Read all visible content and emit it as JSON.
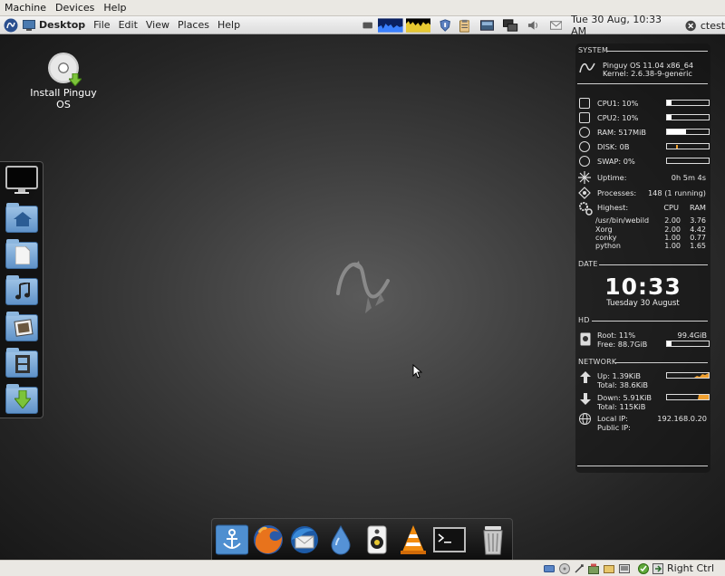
{
  "vbox_menu": {
    "items": [
      "Machine",
      "Devices",
      "Help"
    ]
  },
  "top_panel": {
    "crumb": "Desktop",
    "menus": [
      "File",
      "Edit",
      "View",
      "Places",
      "Help"
    ],
    "datetime": "Tue 30 Aug, 10:33 AM",
    "user": "ctest"
  },
  "desktop": {
    "icons": [
      {
        "label": "Install Pinguy OS",
        "icon": "cd-installer-icon"
      }
    ]
  },
  "left_dock": {
    "items": [
      "monitor-icon",
      "home-folder-icon",
      "documents-folder-icon",
      "music-folder-icon",
      "pictures-folder-icon",
      "videos-folder-icon",
      "downloads-folder-icon"
    ]
  },
  "conky": {
    "system_header": "SYSTEM",
    "os_name": "Pinguy OS 11.04 x86_64",
    "kernel": "Kernel: 2.6.38-9-generic",
    "cpu1": {
      "label": "CPU1: 10%",
      "level": 0.1
    },
    "cpu2": {
      "label": "CPU2: 10%",
      "level": 0.1
    },
    "ram": {
      "label": "RAM: 517MiB",
      "level": 0.45
    },
    "disk": {
      "label": "DISK: 0B",
      "level": 0.0
    },
    "swap": {
      "label": "SWAP: 0%",
      "level": 0.0
    },
    "uptime": {
      "label": "Uptime:",
      "value": "0h 5m 4s"
    },
    "processes": {
      "label": "Processes:",
      "value": "148 (1 running)"
    },
    "highest": {
      "label": "Highest:",
      "cpu_header": "CPU",
      "ram_header": "RAM",
      "rows": [
        {
          "name": "/usr/bin/webild",
          "cpu": "2.00",
          "ram": "3.76"
        },
        {
          "name": "Xorg",
          "cpu": "2.00",
          "ram": "4.42"
        },
        {
          "name": "conky",
          "cpu": "1.00",
          "ram": "0.77"
        },
        {
          "name": "python",
          "cpu": "1.00",
          "ram": "1.65"
        }
      ]
    },
    "date_header": "DATE",
    "time": "10:33",
    "date": "Tuesday 30 August",
    "hd_header": "HD",
    "root": {
      "label": "Root: 11%",
      "value": "99.4GiB",
      "level": 0.11
    },
    "free": {
      "label": "Free: 88.7GiB",
      "level": 0.11
    },
    "network_header": "NETWORK",
    "up": {
      "label": "Up: 1.39KiB",
      "total": "Total: 38.6KiB"
    },
    "down": {
      "label": "Down: 5.91KiB",
      "total": "Total: 115KiB"
    },
    "local_ip": {
      "label": "Local IP:",
      "value": "192.168.0.20"
    },
    "public_ip": {
      "label": "Public IP:"
    }
  },
  "bottom_dock": {
    "items": [
      "anchor-icon",
      "firefox-icon",
      "thunderbird-icon",
      "droplet-icon",
      "speaker-icon",
      "vlc-icon",
      "terminal-icon",
      "trash-icon"
    ]
  },
  "status_bar": {
    "host_key": "Right Ctrl"
  },
  "colors": {
    "accent_orange": "#f0a030",
    "folder_blue": "#6fa0d4",
    "panel_bg": "#e6e6e6"
  }
}
